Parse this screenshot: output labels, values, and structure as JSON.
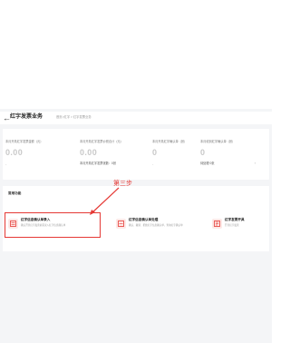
{
  "header": {
    "back_icon": "arrow-left-icon",
    "title": "红字发票业务",
    "breadcrumb": "首页>红字 > 红字发票业务"
  },
  "stats": [
    {
      "label": "本月开具红字发票金额（元）",
      "value": "0.00",
      "extra": "-"
    },
    {
      "label": "本月开具红字发票价税合计（元）",
      "value": "0.00",
      "extra": "本月开具红字发票张数：0张"
    },
    {
      "label": "本月开具红字确认单（张）",
      "value": "0",
      "extra": "-"
    },
    {
      "label": "本月收到红字确认单（张）",
      "value": "0",
      "extra": "待处理 0张"
    }
  ],
  "functions": {
    "heading": "常用功能",
    "annotation": "第三步",
    "items": [
      {
        "title": "红字信息确认单录入",
        "desc": "确认开具红字发票前需录入红字信息确认单",
        "icon": "document-icon"
      },
      {
        "title": "红字信息确认单处理",
        "desc": "确认、撤销、拒绝红字信息确认单，查询红字确认单",
        "icon": "document-check-icon"
      },
      {
        "title": "红字发票开具",
        "desc": "开具红字发票",
        "icon": "invoice-icon"
      }
    ]
  },
  "colors": {
    "accent": "#e53935",
    "icon_bg": "#fde8e6",
    "panel_bg": "#f4f5f7"
  }
}
